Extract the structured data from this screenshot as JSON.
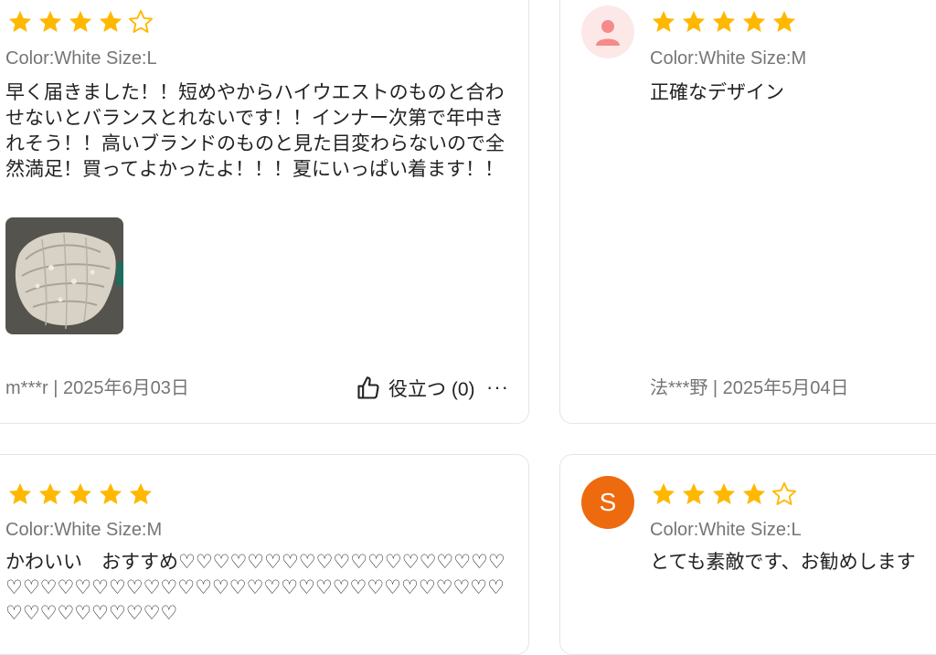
{
  "reviews": [
    {
      "rating": 4,
      "variant": "Color:White Size:L",
      "text": "早く届きました！！短めやからハイウエストのものと合わせないとバランスとれないです！！インナー次第で年中きれそう！！高いブランドのものと見た目変わらないので全然満足！買ってよかったよ！！！夏にいっぱい着ます！！",
      "author_date": "m***r | 2025年6月03日",
      "helpful_label": "役立つ (0)",
      "more_label": "···",
      "photo_icon": "review-photo"
    },
    {
      "rating": 5,
      "variant": "Color:White Size:M",
      "text": "正確なデザイン",
      "author_date": "法***野 | 2025年5月04日",
      "avatar_icon": "default-user-icon"
    },
    {
      "rating": 5,
      "variant": "Color:White Size:M",
      "text": "かわいい　おすすめ♡♡♡♡♡♡♡♡♡♡♡♡♡♡♡♡♡♡♡♡♡♡♡♡♡♡♡♡♡♡♡♡♡♡♡♡♡♡♡♡♡♡♡♡♡♡♡♡♡♡♡♡♡♡♡♡♡♡"
    },
    {
      "rating": 4,
      "variant": "Color:White Size:L",
      "text": "とても素敵です、お勧めします",
      "avatar_letter": "S"
    }
  ],
  "colors": {
    "star_filled": "#ffb800",
    "star_empty_outline": "#ffb800",
    "avatar_letter_bg": "#ee6a0f",
    "avatar_default_bg": "#fde8e8",
    "avatar_default_icon": "#f48a8a",
    "muted_text": "#757575"
  }
}
